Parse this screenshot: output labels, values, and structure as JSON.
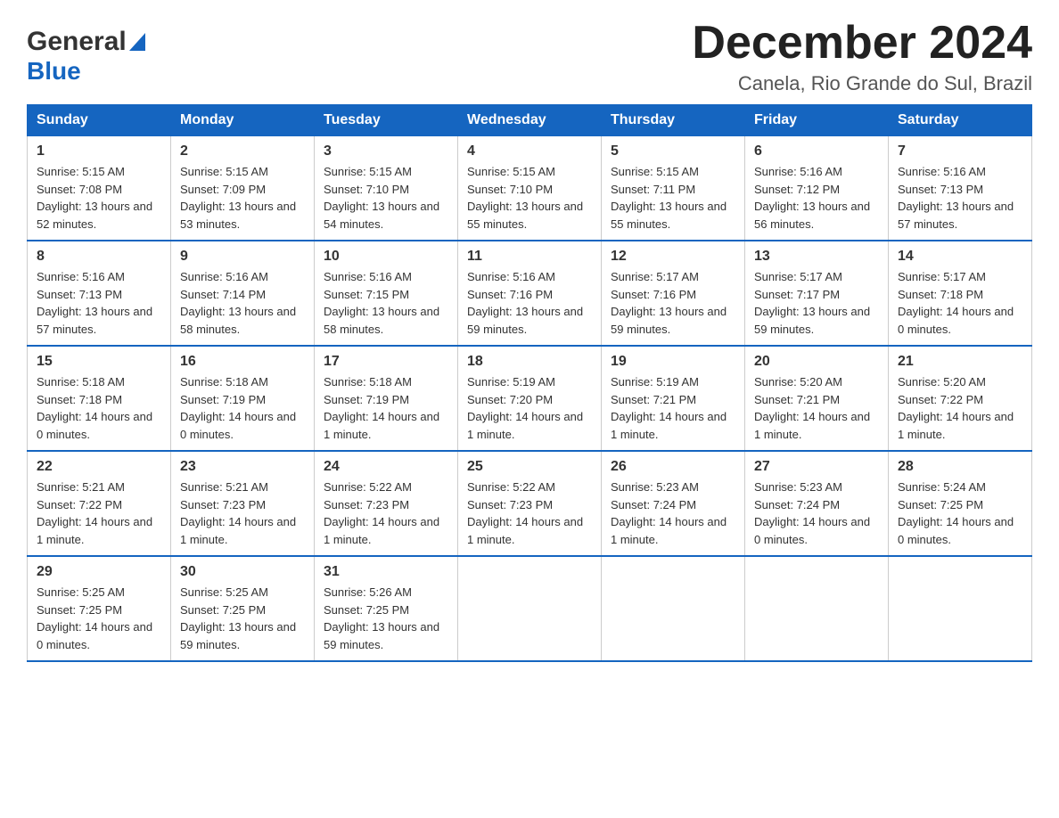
{
  "header": {
    "logo_general": "General",
    "logo_blue": "Blue",
    "month_title": "December 2024",
    "location": "Canela, Rio Grande do Sul, Brazil"
  },
  "weekdays": [
    "Sunday",
    "Monday",
    "Tuesday",
    "Wednesday",
    "Thursday",
    "Friday",
    "Saturday"
  ],
  "weeks": [
    [
      {
        "day": "1",
        "sunrise": "Sunrise: 5:15 AM",
        "sunset": "Sunset: 7:08 PM",
        "daylight": "Daylight: 13 hours and 52 minutes."
      },
      {
        "day": "2",
        "sunrise": "Sunrise: 5:15 AM",
        "sunset": "Sunset: 7:09 PM",
        "daylight": "Daylight: 13 hours and 53 minutes."
      },
      {
        "day": "3",
        "sunrise": "Sunrise: 5:15 AM",
        "sunset": "Sunset: 7:10 PM",
        "daylight": "Daylight: 13 hours and 54 minutes."
      },
      {
        "day": "4",
        "sunrise": "Sunrise: 5:15 AM",
        "sunset": "Sunset: 7:10 PM",
        "daylight": "Daylight: 13 hours and 55 minutes."
      },
      {
        "day": "5",
        "sunrise": "Sunrise: 5:15 AM",
        "sunset": "Sunset: 7:11 PM",
        "daylight": "Daylight: 13 hours and 55 minutes."
      },
      {
        "day": "6",
        "sunrise": "Sunrise: 5:16 AM",
        "sunset": "Sunset: 7:12 PM",
        "daylight": "Daylight: 13 hours and 56 minutes."
      },
      {
        "day": "7",
        "sunrise": "Sunrise: 5:16 AM",
        "sunset": "Sunset: 7:13 PM",
        "daylight": "Daylight: 13 hours and 57 minutes."
      }
    ],
    [
      {
        "day": "8",
        "sunrise": "Sunrise: 5:16 AM",
        "sunset": "Sunset: 7:13 PM",
        "daylight": "Daylight: 13 hours and 57 minutes."
      },
      {
        "day": "9",
        "sunrise": "Sunrise: 5:16 AM",
        "sunset": "Sunset: 7:14 PM",
        "daylight": "Daylight: 13 hours and 58 minutes."
      },
      {
        "day": "10",
        "sunrise": "Sunrise: 5:16 AM",
        "sunset": "Sunset: 7:15 PM",
        "daylight": "Daylight: 13 hours and 58 minutes."
      },
      {
        "day": "11",
        "sunrise": "Sunrise: 5:16 AM",
        "sunset": "Sunset: 7:16 PM",
        "daylight": "Daylight: 13 hours and 59 minutes."
      },
      {
        "day": "12",
        "sunrise": "Sunrise: 5:17 AM",
        "sunset": "Sunset: 7:16 PM",
        "daylight": "Daylight: 13 hours and 59 minutes."
      },
      {
        "day": "13",
        "sunrise": "Sunrise: 5:17 AM",
        "sunset": "Sunset: 7:17 PM",
        "daylight": "Daylight: 13 hours and 59 minutes."
      },
      {
        "day": "14",
        "sunrise": "Sunrise: 5:17 AM",
        "sunset": "Sunset: 7:18 PM",
        "daylight": "Daylight: 14 hours and 0 minutes."
      }
    ],
    [
      {
        "day": "15",
        "sunrise": "Sunrise: 5:18 AM",
        "sunset": "Sunset: 7:18 PM",
        "daylight": "Daylight: 14 hours and 0 minutes."
      },
      {
        "day": "16",
        "sunrise": "Sunrise: 5:18 AM",
        "sunset": "Sunset: 7:19 PM",
        "daylight": "Daylight: 14 hours and 0 minutes."
      },
      {
        "day": "17",
        "sunrise": "Sunrise: 5:18 AM",
        "sunset": "Sunset: 7:19 PM",
        "daylight": "Daylight: 14 hours and 1 minute."
      },
      {
        "day": "18",
        "sunrise": "Sunrise: 5:19 AM",
        "sunset": "Sunset: 7:20 PM",
        "daylight": "Daylight: 14 hours and 1 minute."
      },
      {
        "day": "19",
        "sunrise": "Sunrise: 5:19 AM",
        "sunset": "Sunset: 7:21 PM",
        "daylight": "Daylight: 14 hours and 1 minute."
      },
      {
        "day": "20",
        "sunrise": "Sunrise: 5:20 AM",
        "sunset": "Sunset: 7:21 PM",
        "daylight": "Daylight: 14 hours and 1 minute."
      },
      {
        "day": "21",
        "sunrise": "Sunrise: 5:20 AM",
        "sunset": "Sunset: 7:22 PM",
        "daylight": "Daylight: 14 hours and 1 minute."
      }
    ],
    [
      {
        "day": "22",
        "sunrise": "Sunrise: 5:21 AM",
        "sunset": "Sunset: 7:22 PM",
        "daylight": "Daylight: 14 hours and 1 minute."
      },
      {
        "day": "23",
        "sunrise": "Sunrise: 5:21 AM",
        "sunset": "Sunset: 7:23 PM",
        "daylight": "Daylight: 14 hours and 1 minute."
      },
      {
        "day": "24",
        "sunrise": "Sunrise: 5:22 AM",
        "sunset": "Sunset: 7:23 PM",
        "daylight": "Daylight: 14 hours and 1 minute."
      },
      {
        "day": "25",
        "sunrise": "Sunrise: 5:22 AM",
        "sunset": "Sunset: 7:23 PM",
        "daylight": "Daylight: 14 hours and 1 minute."
      },
      {
        "day": "26",
        "sunrise": "Sunrise: 5:23 AM",
        "sunset": "Sunset: 7:24 PM",
        "daylight": "Daylight: 14 hours and 1 minute."
      },
      {
        "day": "27",
        "sunrise": "Sunrise: 5:23 AM",
        "sunset": "Sunset: 7:24 PM",
        "daylight": "Daylight: 14 hours and 0 minutes."
      },
      {
        "day": "28",
        "sunrise": "Sunrise: 5:24 AM",
        "sunset": "Sunset: 7:25 PM",
        "daylight": "Daylight: 14 hours and 0 minutes."
      }
    ],
    [
      {
        "day": "29",
        "sunrise": "Sunrise: 5:25 AM",
        "sunset": "Sunset: 7:25 PM",
        "daylight": "Daylight: 14 hours and 0 minutes."
      },
      {
        "day": "30",
        "sunrise": "Sunrise: 5:25 AM",
        "sunset": "Sunset: 7:25 PM",
        "daylight": "Daylight: 13 hours and 59 minutes."
      },
      {
        "day": "31",
        "sunrise": "Sunrise: 5:26 AM",
        "sunset": "Sunset: 7:25 PM",
        "daylight": "Daylight: 13 hours and 59 minutes."
      },
      null,
      null,
      null,
      null
    ]
  ]
}
